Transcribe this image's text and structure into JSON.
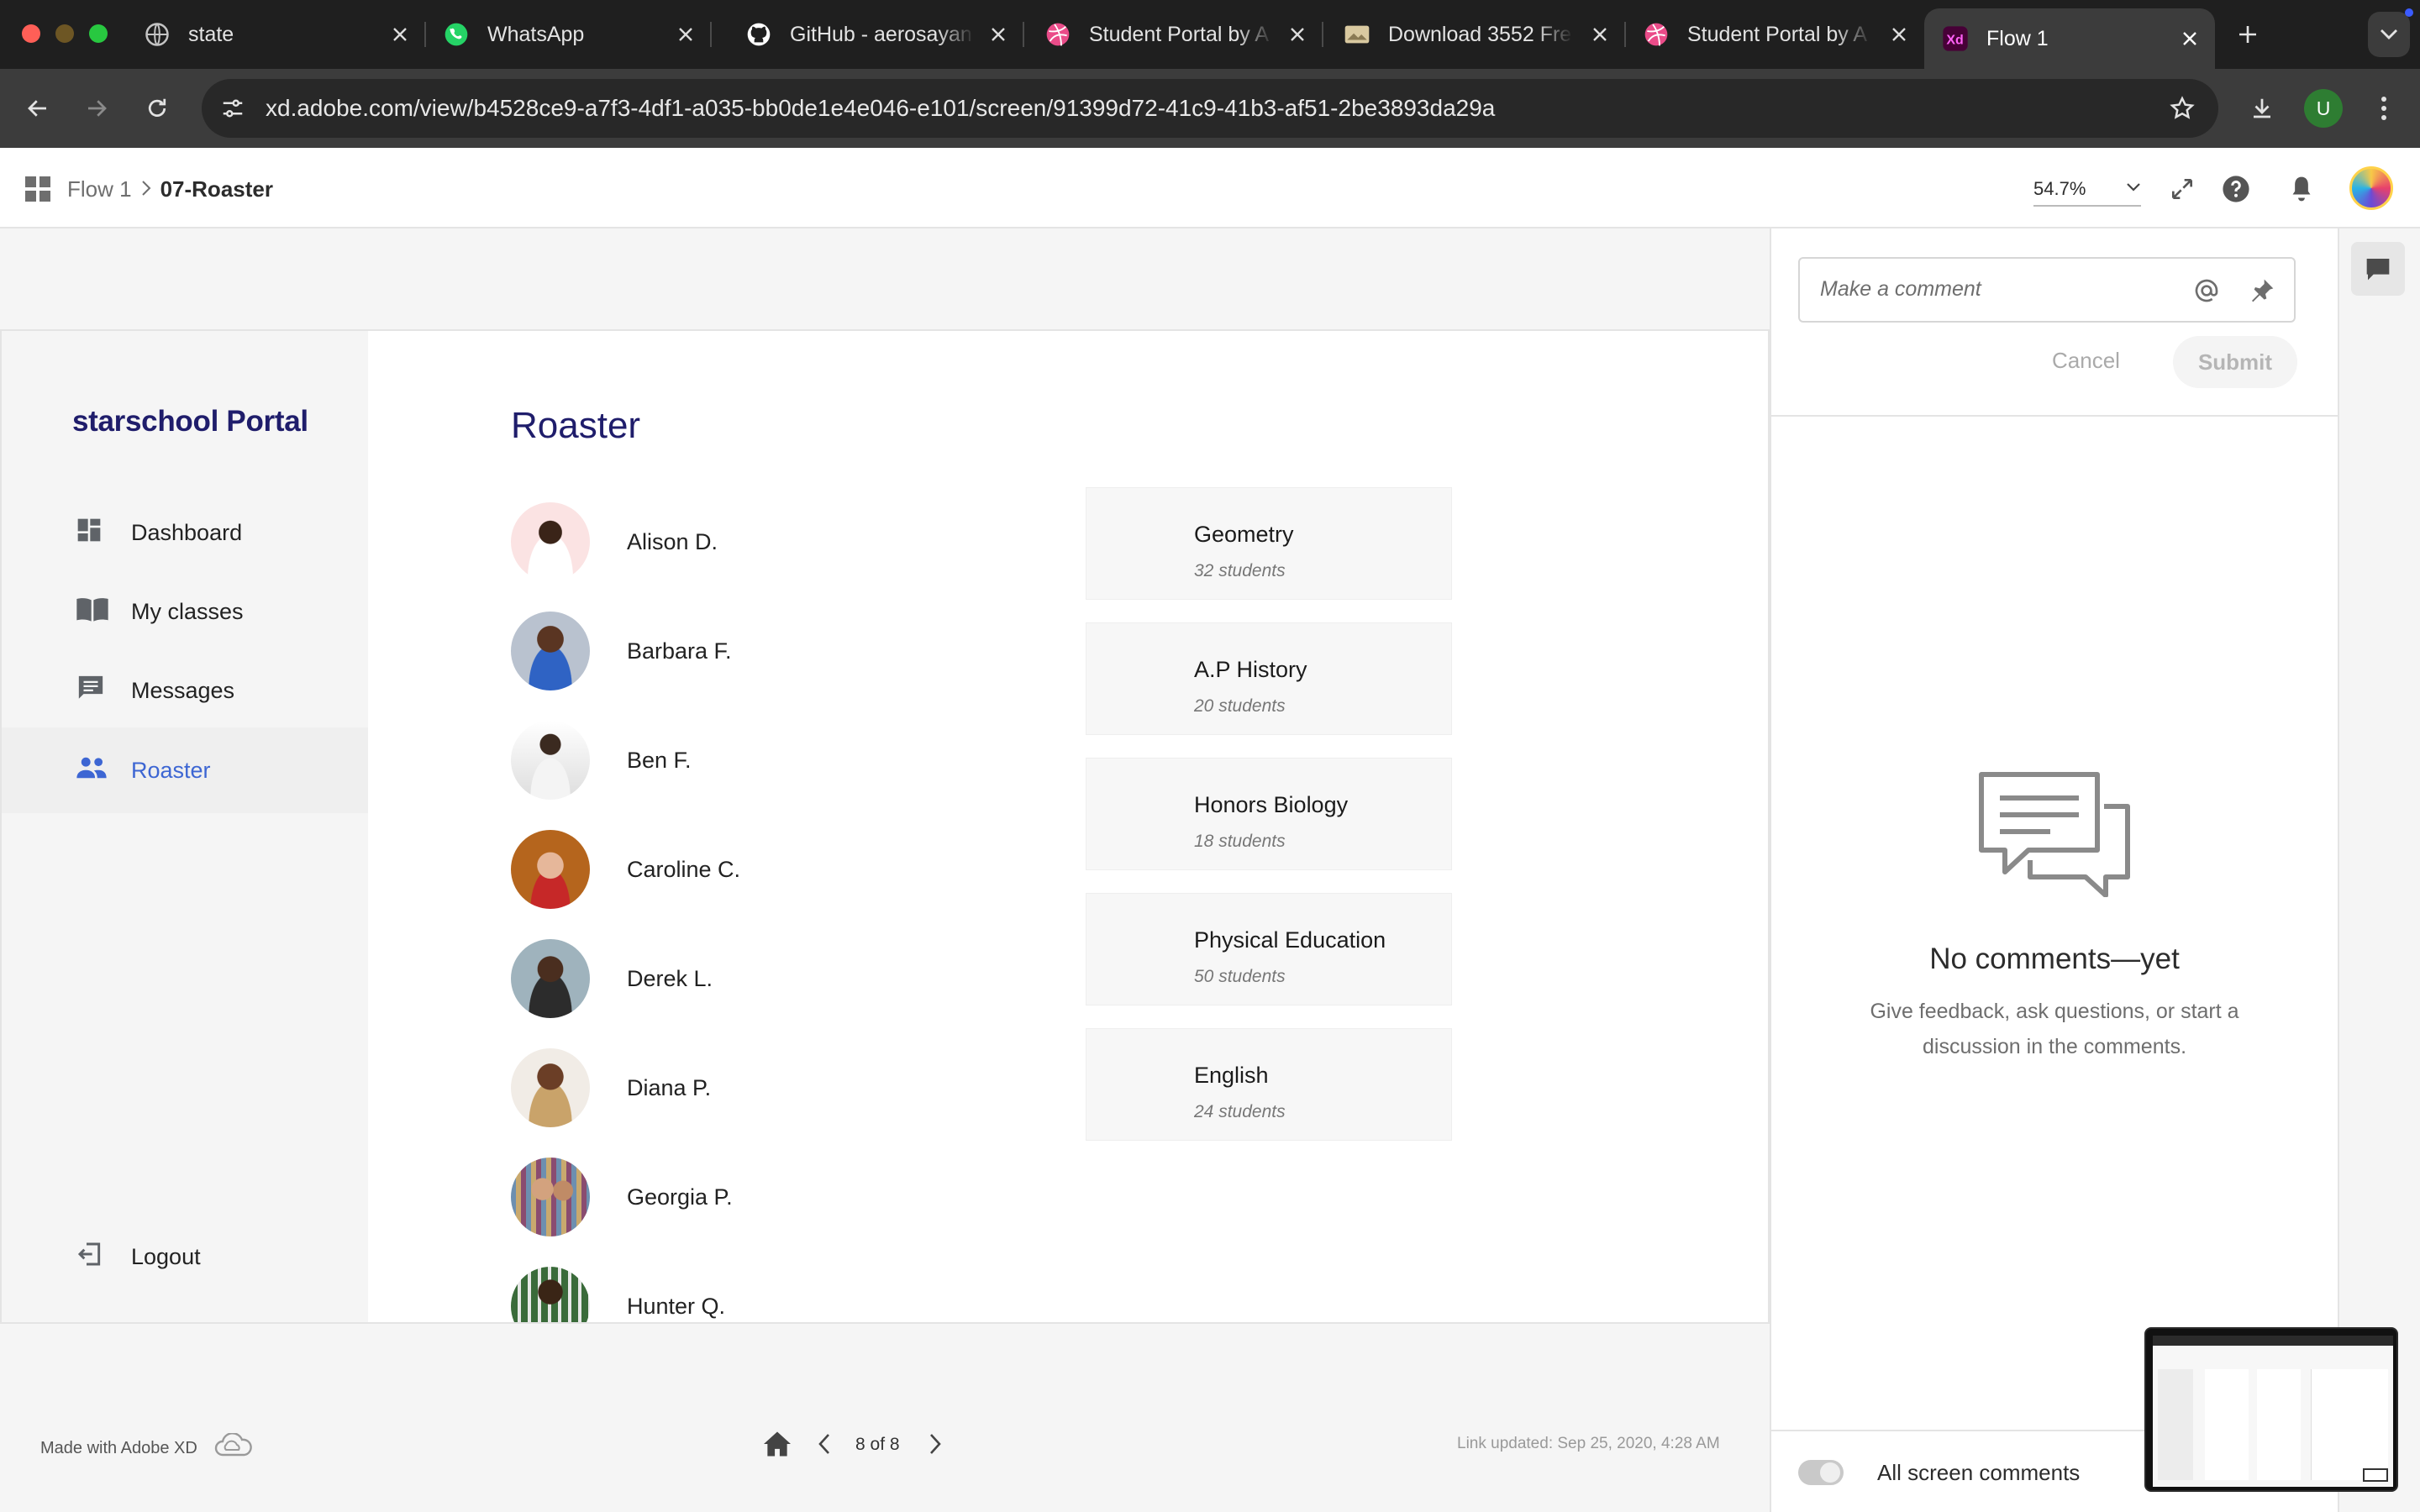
{
  "browser": {
    "tabs": [
      {
        "title": "state",
        "icon": "globe-icon"
      },
      {
        "title": "WhatsApp",
        "icon": "whatsapp-icon"
      },
      {
        "title": "GitHub - aerosayan",
        "icon": "github-icon"
      },
      {
        "title": "Student Portal by A",
        "icon": "dribbble-icon"
      },
      {
        "title": "Download 3552 Fre",
        "icon": "image-icon"
      },
      {
        "title": "Student Portal by A",
        "icon": "dribbble-icon"
      },
      {
        "title": "Flow 1",
        "icon": "adobe-xd-icon"
      }
    ],
    "url": "xd.adobe.com/view/b4528ce9-a7f3-4df1-a035-bb0de1e4e046-e101/screen/91399d72-41c9-41b3-af51-2be3893da29a",
    "profile_initial": "U"
  },
  "xd": {
    "breadcrumb_root": "Flow 1",
    "breadcrumb_current": "07-Roaster",
    "zoom": "54.7%",
    "made_with": "Made with Adobe XD",
    "page_indicator": "8 of 8",
    "link_updated": "Link updated: Sep 25, 2020, 4:28 AM"
  },
  "portal": {
    "brand": "starschool Portal",
    "nav": [
      {
        "label": "Dashboard",
        "icon": "dashboard-icon"
      },
      {
        "label": "My classes",
        "icon": "book-icon"
      },
      {
        "label": "Messages",
        "icon": "message-icon"
      },
      {
        "label": "Roaster",
        "icon": "people-icon",
        "active": true
      }
    ],
    "logout": "Logout",
    "page_title": "Roaster",
    "students": [
      "Alison D.",
      "Barbara F.",
      "Ben F.",
      "Caroline C.",
      "Derek L.",
      "Diana P.",
      "Georgia P.",
      "Hunter Q."
    ],
    "classes": [
      {
        "name": "Geometry",
        "count": "32 students"
      },
      {
        "name": "A.P History",
        "count": "20 students"
      },
      {
        "name": "Honors Biology",
        "count": "18 students"
      },
      {
        "name": "Physical Education",
        "count": "50 students"
      },
      {
        "name": "English",
        "count": "24 students"
      }
    ]
  },
  "comments": {
    "placeholder": "Make a comment",
    "cancel": "Cancel",
    "submit": "Submit",
    "empty_title": "No comments—yet",
    "empty_body_1": "Give feedback, ask questions, or start a",
    "empty_body_2": "discussion in the comments.",
    "toggle_label": "All screen comments"
  },
  "colors": {
    "accent": "#3d66d3",
    "brand_navy": "#1f1d6b",
    "chrome_bg": "#1f1f1f"
  }
}
